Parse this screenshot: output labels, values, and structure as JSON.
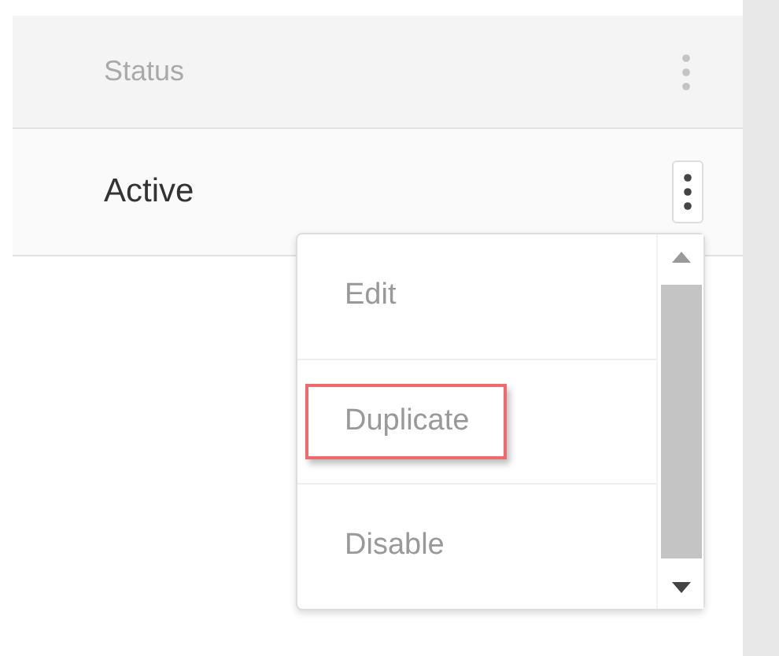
{
  "table": {
    "header": {
      "label": "Status"
    },
    "rows": [
      {
        "status": "Active",
        "menu_open": true
      }
    ]
  },
  "menu": {
    "items": [
      {
        "label": "Edit",
        "highlighted": false
      },
      {
        "label": "Duplicate",
        "highlighted": true
      },
      {
        "label": "Disable",
        "highlighted": false
      }
    ]
  }
}
